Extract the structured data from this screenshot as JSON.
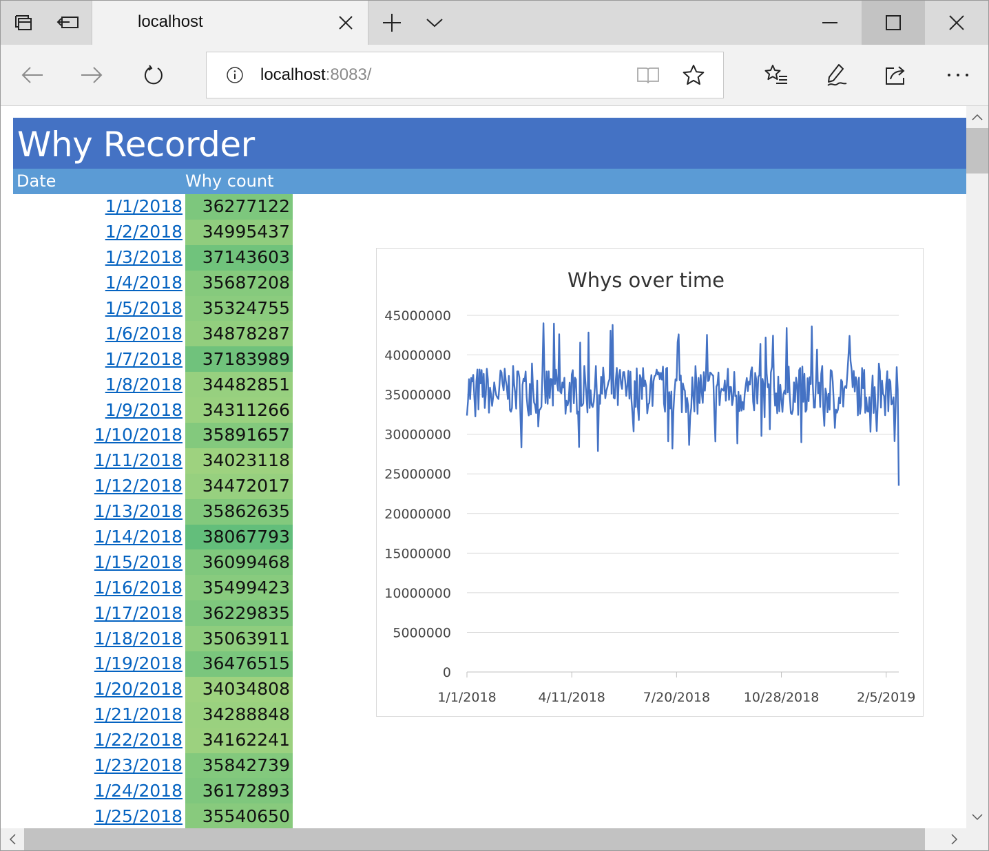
{
  "browser": {
    "tab_title": "localhost",
    "url_host": "localhost",
    "url_rest": ":8083/"
  },
  "page": {
    "title": "Why Recorder",
    "headers": {
      "date": "Date",
      "count": "Why count"
    }
  },
  "rows": [
    {
      "date": "1/1/2018",
      "count": "36277122"
    },
    {
      "date": "1/2/2018",
      "count": "34995437"
    },
    {
      "date": "1/3/2018",
      "count": "37143603"
    },
    {
      "date": "1/4/2018",
      "count": "35687208"
    },
    {
      "date": "1/5/2018",
      "count": "35324755"
    },
    {
      "date": "1/6/2018",
      "count": "34878287"
    },
    {
      "date": "1/7/2018",
      "count": "37183989"
    },
    {
      "date": "1/8/2018",
      "count": "34482851"
    },
    {
      "date": "1/9/2018",
      "count": "34311266"
    },
    {
      "date": "1/10/2018",
      "count": "35891657"
    },
    {
      "date": "1/11/2018",
      "count": "34023118"
    },
    {
      "date": "1/12/2018",
      "count": "34472017"
    },
    {
      "date": "1/13/2018",
      "count": "35862635"
    },
    {
      "date": "1/14/2018",
      "count": "38067793"
    },
    {
      "date": "1/15/2018",
      "count": "36099468"
    },
    {
      "date": "1/16/2018",
      "count": "35499423"
    },
    {
      "date": "1/17/2018",
      "count": "36229835"
    },
    {
      "date": "1/18/2018",
      "count": "35063911"
    },
    {
      "date": "1/19/2018",
      "count": "36476515"
    },
    {
      "date": "1/20/2018",
      "count": "34034808"
    },
    {
      "date": "1/21/2018",
      "count": "34288848"
    },
    {
      "date": "1/22/2018",
      "count": "34162241"
    },
    {
      "date": "1/23/2018",
      "count": "35842739"
    },
    {
      "date": "1/24/2018",
      "count": "36172893"
    },
    {
      "date": "1/25/2018",
      "count": "35540650"
    }
  ],
  "colors": {
    "banner": "#4472c4",
    "header": "#5b9bd5",
    "cell_high": "#63be7b",
    "cell_low": "#9ed27f",
    "link": "#0563c1",
    "series": "#4472c4"
  },
  "chart_data": {
    "type": "line",
    "title": "Whys over time",
    "xlabel": "",
    "ylabel": "",
    "ylim": [
      0,
      45000000
    ],
    "yticks": [
      "0",
      "5000000",
      "10000000",
      "15000000",
      "20000000",
      "25000000",
      "30000000",
      "35000000",
      "40000000",
      "45000000"
    ],
    "xticks": [
      "1/1/2018",
      "4/11/2018",
      "7/20/2018",
      "10/28/2018",
      "2/5/2019"
    ],
    "x_range": [
      "1/1/2018",
      "2/17/2019"
    ],
    "typical_range": [
      30000000,
      42000000
    ],
    "last_value": 23500000,
    "grid": true,
    "legend": "none"
  }
}
